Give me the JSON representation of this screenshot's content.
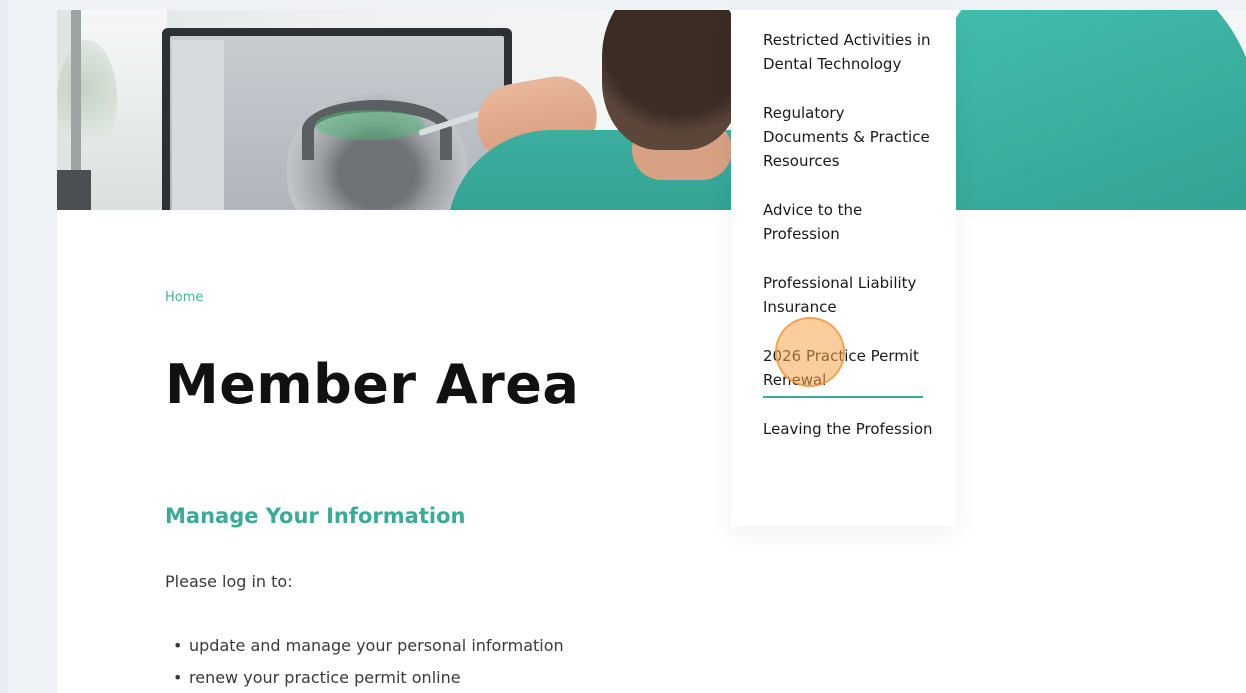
{
  "breadcrumb": {
    "home_label": "Home"
  },
  "page": {
    "title": "Member Area",
    "section_title": "Manage Your Information",
    "intro": "Please log in to:",
    "bullets": [
      "update and manage your personal information",
      "renew your practice permit online"
    ]
  },
  "dropdown": {
    "items": [
      "Restricted Activities in Dental Technology",
      "Regulatory Documents & Practice Resources",
      "Advice to the Profession",
      "Professional Liability Insurance",
      "2026 Practice Permit Renewal",
      "Leaving the Profession"
    ],
    "active_index": 4
  },
  "colors": {
    "accent": "#38ab99",
    "breadcrumb": "#3eb6a5",
    "title": "#111111",
    "cursor_highlight": "#f4a44a"
  },
  "icons": {
    "list_bullet": "bullet-icon"
  }
}
